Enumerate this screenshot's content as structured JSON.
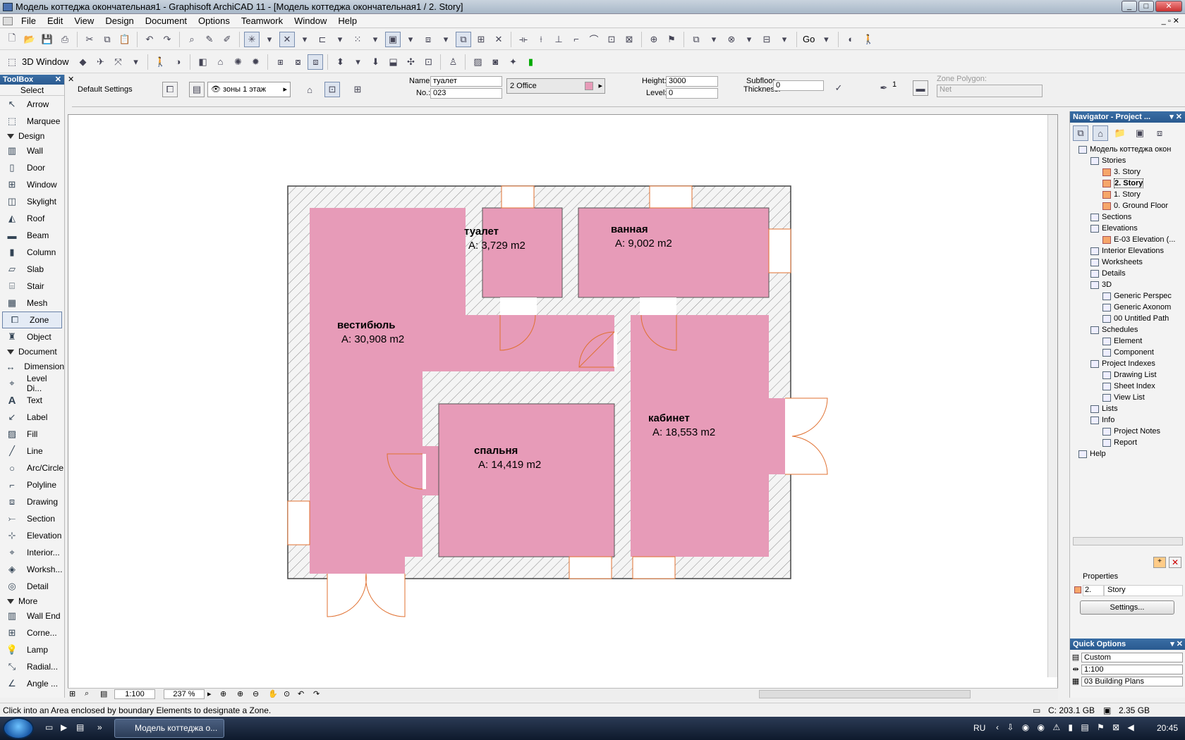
{
  "window": {
    "title": "Модель коттеджа окончательная1 - Graphisoft ArchiCAD 11 - [Модель коттеджа окончательная1 / 2. Story]"
  },
  "menu": [
    "File",
    "Edit",
    "View",
    "Design",
    "Document",
    "Options",
    "Teamwork",
    "Window",
    "Help"
  ],
  "toolbar2": {
    "window_3d_label": "3D Window",
    "go_label": "Go"
  },
  "infobox": {
    "default_settings": "Default Settings",
    "layer": "зоны 1 этаж",
    "name_label": "Name:",
    "name_value": "туалет",
    "no_label": "No.:",
    "no_value": "023",
    "category": "2  Office",
    "height_label": "Height:",
    "height_value": "3000",
    "level_label": "Level:",
    "level_value": "0",
    "subfloor_label": "Subfloor",
    "thickness_label": "Thickness:",
    "subfloor_value": "0",
    "pen_value": "1",
    "zone_polygon_label": "Zone Polygon:",
    "zone_polygon_value": "Net"
  },
  "toolbox": {
    "title": "ToolBox",
    "select": "Select",
    "arrow": "Arrow",
    "marquee": "Marquee",
    "design_section": "Design",
    "design_tools": [
      "Wall",
      "Door",
      "Window",
      "Skylight",
      "Roof",
      "Beam",
      "Column",
      "Slab",
      "Stair",
      "Mesh",
      "Zone",
      "Object"
    ],
    "document_section": "Document",
    "document_tools": [
      "Dimension",
      "Level Di...",
      "Text",
      "Label",
      "Fill",
      "Line",
      "Arc/Circle",
      "Polyline",
      "Drawing",
      "Section",
      "Elevation",
      "Interior...",
      "Worksh...",
      "Detail"
    ],
    "more_section": "More",
    "more_tools": [
      "Wall End",
      "Corne...",
      "Lamp",
      "Radial...",
      "Angle ..."
    ]
  },
  "zones": [
    {
      "name": "туалет",
      "area": "A: 3,729 m2"
    },
    {
      "name": "ванная",
      "area": "A: 9,002 m2"
    },
    {
      "name": "вестибюль",
      "area": "A: 30,908 m2"
    },
    {
      "name": "кабинет",
      "area": "A: 18,553 m2"
    },
    {
      "name": "спальня",
      "area": "A: 14,419 m2"
    }
  ],
  "navbar": {
    "scale": "1:100",
    "zoom": "237 %"
  },
  "navigator": {
    "title": "Navigator - Project ...",
    "items": [
      {
        "label": "Модель коттеджа окон",
        "depth": 0,
        "icon": "house"
      },
      {
        "label": "Stories",
        "depth": 1,
        "icon": "folder"
      },
      {
        "label": "3. Story",
        "depth": 2,
        "icon": "story"
      },
      {
        "label": "2. Story",
        "depth": 2,
        "icon": "story"
      },
      {
        "label": "1. Story",
        "depth": 2,
        "icon": "story"
      },
      {
        "label": "0. Ground Floor",
        "depth": 2,
        "icon": "story"
      },
      {
        "label": "Sections",
        "depth": 1,
        "icon": "folder"
      },
      {
        "label": "Elevations",
        "depth": 1,
        "icon": "folder"
      },
      {
        "label": "E-03 Elevation (...",
        "depth": 2,
        "icon": "story"
      },
      {
        "label": "Interior Elevations",
        "depth": 1,
        "icon": "folder"
      },
      {
        "label": "Worksheets",
        "depth": 1,
        "icon": "folder"
      },
      {
        "label": "Details",
        "depth": 1,
        "icon": "folder"
      },
      {
        "label": "3D",
        "depth": 1,
        "icon": "folder"
      },
      {
        "label": "Generic Perspec",
        "depth": 2,
        "icon": "view"
      },
      {
        "label": "Generic Axonom",
        "depth": 2,
        "icon": "view"
      },
      {
        "label": "00 Untitled Path",
        "depth": 2,
        "icon": "view"
      },
      {
        "label": "Schedules",
        "depth": 1,
        "icon": "folder"
      },
      {
        "label": "Element",
        "depth": 2,
        "icon": "view"
      },
      {
        "label": "Component",
        "depth": 2,
        "icon": "view"
      },
      {
        "label": "Project Indexes",
        "depth": 1,
        "icon": "folder"
      },
      {
        "label": "Drawing List",
        "depth": 2,
        "icon": "view"
      },
      {
        "label": "Sheet Index",
        "depth": 2,
        "icon": "view"
      },
      {
        "label": "View List",
        "depth": 2,
        "icon": "view"
      },
      {
        "label": "Lists",
        "depth": 1,
        "icon": "folder"
      },
      {
        "label": "Info",
        "depth": 1,
        "icon": "folder"
      },
      {
        "label": "Project Notes",
        "depth": 2,
        "icon": "view"
      },
      {
        "label": "Report",
        "depth": 2,
        "icon": "view"
      },
      {
        "label": "Help",
        "depth": 0,
        "icon": "folder"
      }
    ],
    "selected": "2. Story",
    "properties_label": "Properties",
    "prop_id": "2.",
    "prop_name": "Story",
    "settings_button": "Settings..."
  },
  "quick_options": {
    "title": "Quick Options",
    "options": [
      "Custom",
      "1:100",
      "03 Building Plans"
    ]
  },
  "status": {
    "hint": "Click into an Area enclosed by boundary Elements to designate a Zone.",
    "disk": "C: 203.1 GB",
    "ram": "2.35 GB"
  },
  "taskbar": {
    "task": "Модель коттеджа о...",
    "lang": "RU",
    "clock": "20:45"
  },
  "colors": {
    "zone_fill": "#e79bb8",
    "wall_hatch": "#8a8a8a",
    "door_line": "#e07030",
    "accent": "#2a5a90"
  }
}
